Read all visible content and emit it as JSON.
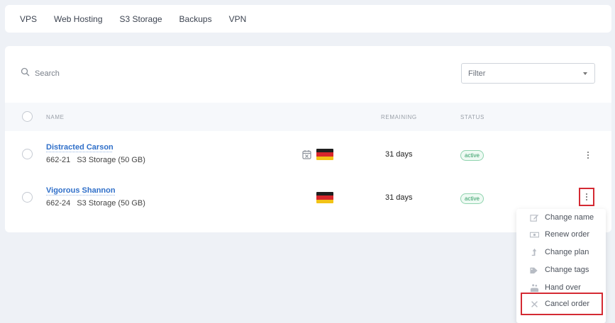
{
  "nav": {
    "tabs": [
      "VPS",
      "Web Hosting",
      "S3 Storage",
      "Backups",
      "VPN"
    ]
  },
  "search": {
    "placeholder": "Search",
    "value": ""
  },
  "filter": {
    "label": "Filter"
  },
  "table": {
    "headers": {
      "name": "NAME",
      "remaining": "REMAINING",
      "status": "STATUS"
    },
    "rows": [
      {
        "name": "Distracted Carson",
        "id": "662-21",
        "product": "S3 Storage (50 GB)",
        "remaining": "31 days",
        "status": "active",
        "has_schedule_icon": true,
        "flag": "germany-flag"
      },
      {
        "name": "Vigorous Shannon",
        "id": "662-24",
        "product": "S3 Storage (50 GB)",
        "remaining": "31 days",
        "status": "active",
        "has_schedule_icon": false,
        "flag": "germany-flag"
      }
    ]
  },
  "menu": {
    "items": [
      {
        "label": "Change name",
        "icon": "edit-icon"
      },
      {
        "label": "Renew order",
        "icon": "money-icon"
      },
      {
        "label": "Change plan",
        "icon": "arrow-up-icon"
      },
      {
        "label": "Change tags",
        "icon": "tag-icon"
      },
      {
        "label": "Hand over",
        "icon": "hand-over-icon"
      },
      {
        "label": "Cancel order",
        "icon": "close-icon"
      }
    ]
  },
  "colors": {
    "link": "#2f6fc9",
    "status_active": "#2f9b63",
    "highlight": "#d42a33",
    "flag": [
      "#1f1f1f",
      "#d8262c",
      "#f3c316"
    ]
  }
}
